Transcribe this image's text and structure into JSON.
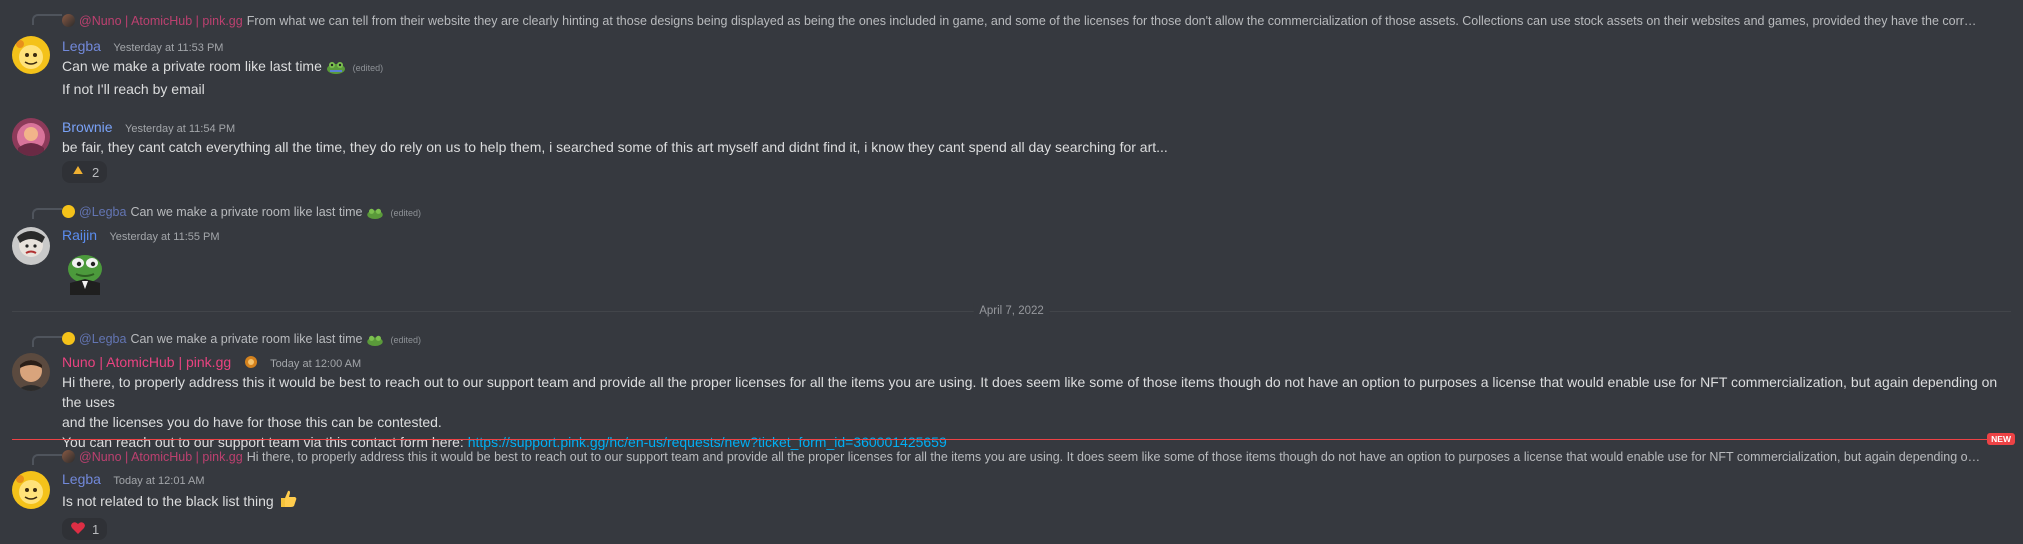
{
  "users": {
    "legba": {
      "name": "Legba",
      "color": "#7289da"
    },
    "brownie": {
      "name": "Brownie",
      "color": "#7aa2f7"
    },
    "raijin": {
      "name": "Raijin",
      "color": "#5b8def"
    },
    "nuno": {
      "name": "Nuno | AtomicHub | pink.gg",
      "color": "#e94380"
    }
  },
  "messages": [
    {
      "reply": {
        "mention": "@Nuno | AtomicHub | pink.gg",
        "text": "From what we can tell from their website they are clearly hinting at those designs being displayed as being the ones included in game, and some of the licenses for those don't allow the commercialization of those assets. Collections can use stock assets on their websites and games, provided they have the correct licenses, though the..."
      },
      "author": "Legba",
      "timestamp": "Yesterday at 11:53 PM",
      "lines": [
        "Can we make a private room like last time",
        "If not I'll reach by email"
      ],
      "edited": "(edited)"
    },
    {
      "author": "Brownie",
      "timestamp": "Yesterday at 11:54 PM",
      "lines": [
        "be fair, they cant catch everything all the time, they do rely on us to help them, i searched some of this art myself and didnt find it, i know they cant spend all day searching for art..."
      ],
      "reaction": {
        "emoji": "this-emoji",
        "count": "2"
      }
    },
    {
      "reply": {
        "mention": "@Legba",
        "text": "Can we make a private room like last time",
        "edited": "(edited)"
      },
      "author": "Raijin",
      "timestamp": "Yesterday at 11:55 PM",
      "sticker": "pepe-sticker"
    },
    {
      "reply": {
        "mention": "@Legba",
        "text": "Can we make a private room like last time",
        "edited": "(edited)"
      },
      "author": "Nuno | AtomicHub | pink.gg",
      "timestamp": "Today at 12:00 AM",
      "lines": [
        "Hi there, to properly address this it would be best to reach out to our support team and provide all the proper licenses for all the items you are using. It does seem like some of those items though do not have an option to purposes a license that would enable use for NFT commercialization, but again depending on the uses",
        "and the licenses you do have for those this can be contested."
      ],
      "link_prefix": "You can reach out to our support team via this contact form here: ",
      "link": "https://support.pink.gg/hc/en-us/requests/new?ticket_form_id=360001425659"
    },
    {
      "reply": {
        "mention": "@Nuno | AtomicHub | pink.gg",
        "text": "Hi there, to properly address this it would be best to reach out to our support team and provide all the proper licenses for all the items you are using. It does seem like some of those items though do not have an option to purposes a license that would enable use for NFT commercialization, but again depending on the uses and the lice..."
      },
      "author": "Legba",
      "timestamp": "Today at 12:01 AM",
      "lines": [
        "Is not related to the black list thing"
      ],
      "reaction": {
        "emoji": "heart",
        "count": "1"
      }
    }
  ],
  "date_divider": "April 7, 2022",
  "new_badge": "NEW",
  "colors": {
    "background": "#36393f",
    "link": "#00aff4",
    "new": "#ed4245"
  }
}
